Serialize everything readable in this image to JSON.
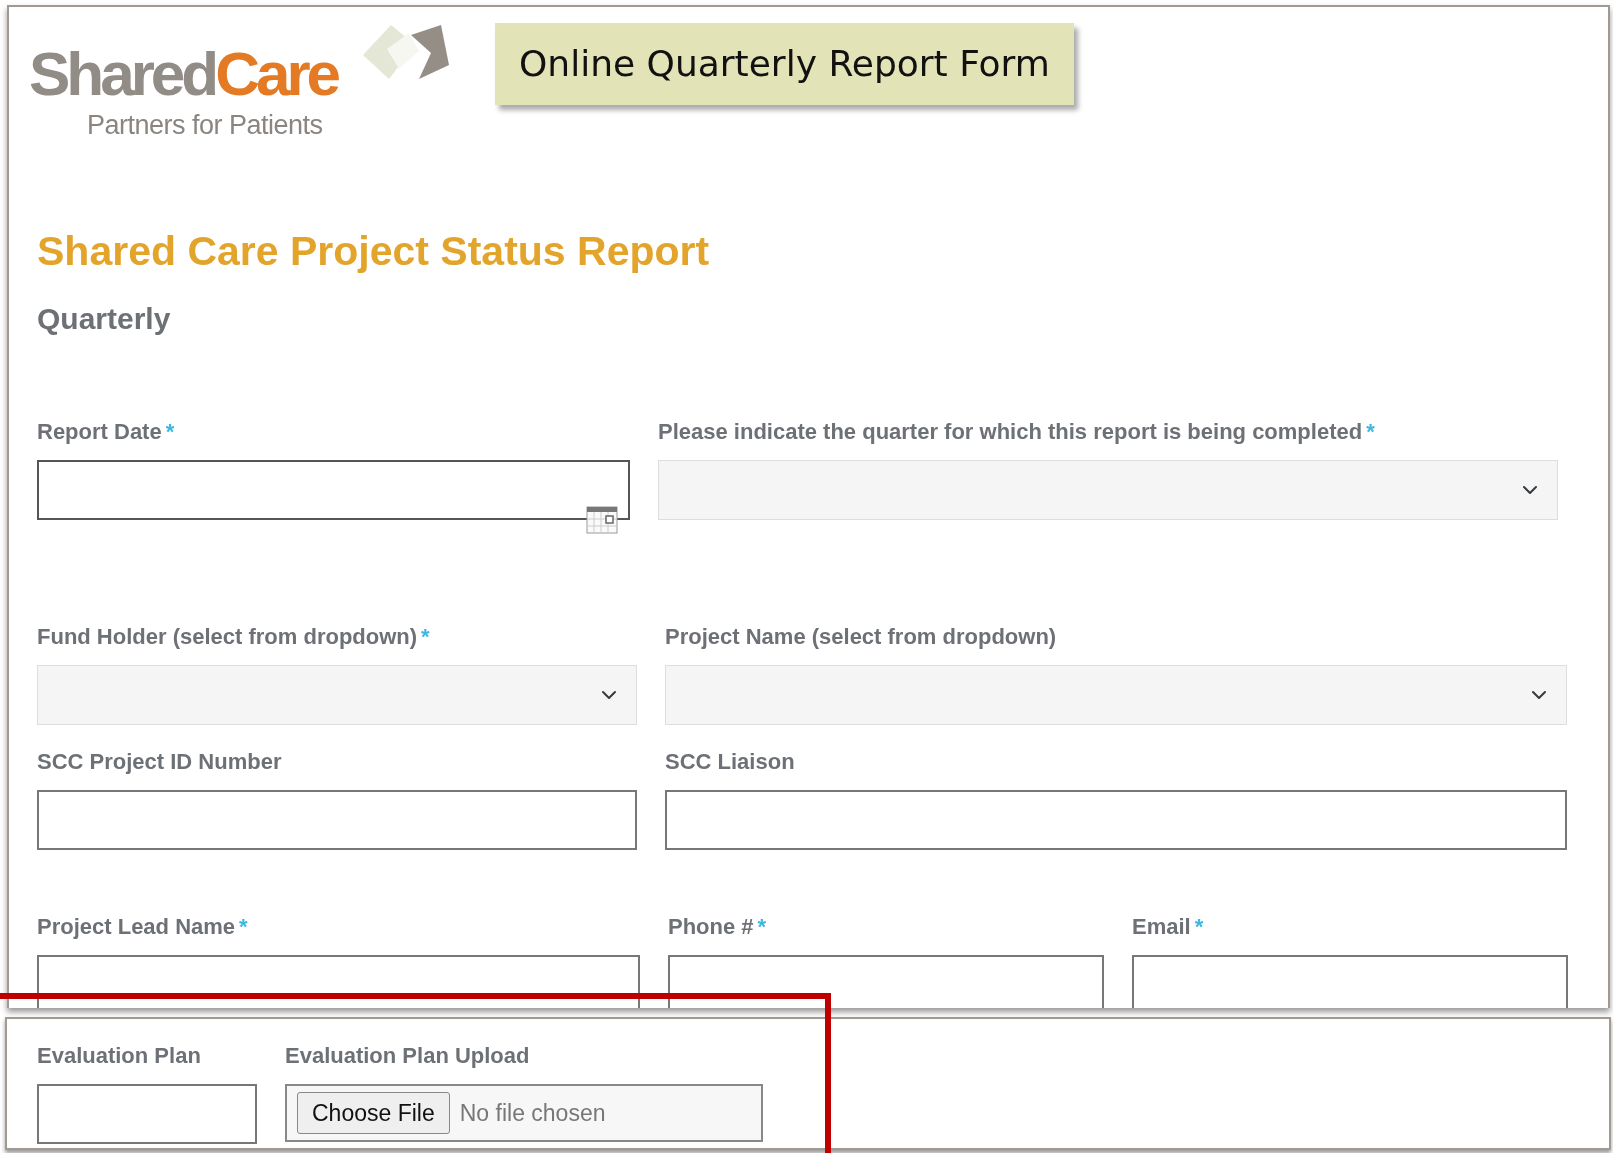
{
  "logo": {
    "word_1": "Shared",
    "word_2": "Care",
    "tagline": "Partners for Patients"
  },
  "banner": "Online Quarterly Report Form",
  "heading": "Shared Care Project Status Report",
  "subheading": "Quarterly",
  "rows": [
    {
      "fields": [
        {
          "label": "Report Date",
          "required_mark": "*",
          "kind": "date"
        },
        {
          "label": "Please indicate the quarter for which this report is being completed",
          "required_mark": "*",
          "kind": "select"
        }
      ]
    },
    {
      "fields": [
        {
          "label": "Fund Holder (select from dropdown)",
          "required_mark": "*",
          "kind": "select"
        },
        {
          "label": "Project Name (select from dropdown)",
          "kind": "select"
        }
      ]
    },
    {
      "fields": [
        {
          "label": "SCC Project ID Number",
          "kind": "text"
        },
        {
          "label": "SCC Liaison",
          "kind": "text"
        }
      ]
    },
    {
      "fields": [
        {
          "label": "Project Lead Name",
          "required_mark": "*",
          "kind": "text"
        },
        {
          "label": "Phone #",
          "required_mark": "*",
          "kind": "text"
        },
        {
          "label": "Email",
          "required_mark": "*",
          "kind": "text"
        }
      ]
    }
  ],
  "bottom_panel": {
    "fields": [
      {
        "label": "Evaluation Plan",
        "kind": "text"
      },
      {
        "label": "Evaluation Plan Upload",
        "kind": "file",
        "button": "Choose File",
        "status": "No file chosen"
      }
    ]
  }
}
